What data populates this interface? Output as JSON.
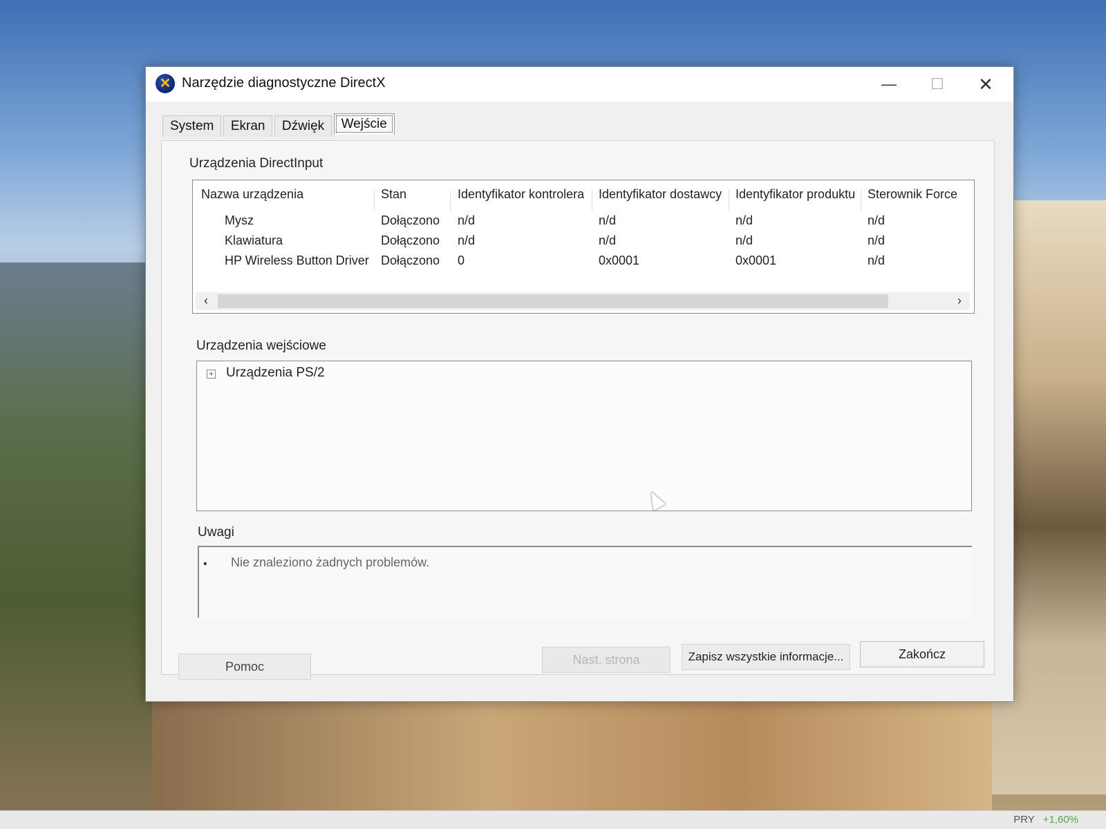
{
  "window": {
    "title": "Narzędzie diagnostyczne DirectX",
    "icon": "directx-icon",
    "controls": {
      "minimize": "—",
      "maximize": "☐",
      "close": "✕"
    }
  },
  "tabs": [
    {
      "label": "System"
    },
    {
      "label": "Ekran"
    },
    {
      "label": "Dźwięk"
    },
    {
      "label": "Wejście"
    }
  ],
  "directinput": {
    "label": "Urządzenia DirectInput",
    "columns": [
      "Nazwa urządzenia",
      "Stan",
      "Identyfikator kontrolera",
      "Identyfikator dostawcy",
      "Identyfikator produktu",
      "Sterownik Force"
    ],
    "rows": [
      [
        "Mysz",
        "Dołączono",
        "n/d",
        "n/d",
        "n/d",
        "n/d"
      ],
      [
        "Klawiatura",
        "Dołączono",
        "n/d",
        "n/d",
        "n/d",
        "n/d"
      ],
      [
        "HP Wireless Button Driver",
        "Dołączono",
        "0",
        "0x0001",
        "0x0001",
        "n/d"
      ]
    ],
    "scroll": {
      "left": "‹",
      "right": "›"
    }
  },
  "input_devices": {
    "label": "Urządzenia wejściowe",
    "tree": [
      {
        "label": "Urządzenia PS/2",
        "expander": "+"
      }
    ]
  },
  "notes": {
    "label": "Uwagi",
    "items": [
      {
        "bullet": "•",
        "text": "Nie znaleziono żadnych problemów."
      }
    ]
  },
  "buttons": {
    "help": "Pomoc",
    "next": "Nast. strona",
    "save": "Zapisz wszystkie informacje...",
    "exit": "Zakończ"
  },
  "taskbar": {
    "tray_text": "PRY",
    "tray_value": "+1,60%"
  }
}
